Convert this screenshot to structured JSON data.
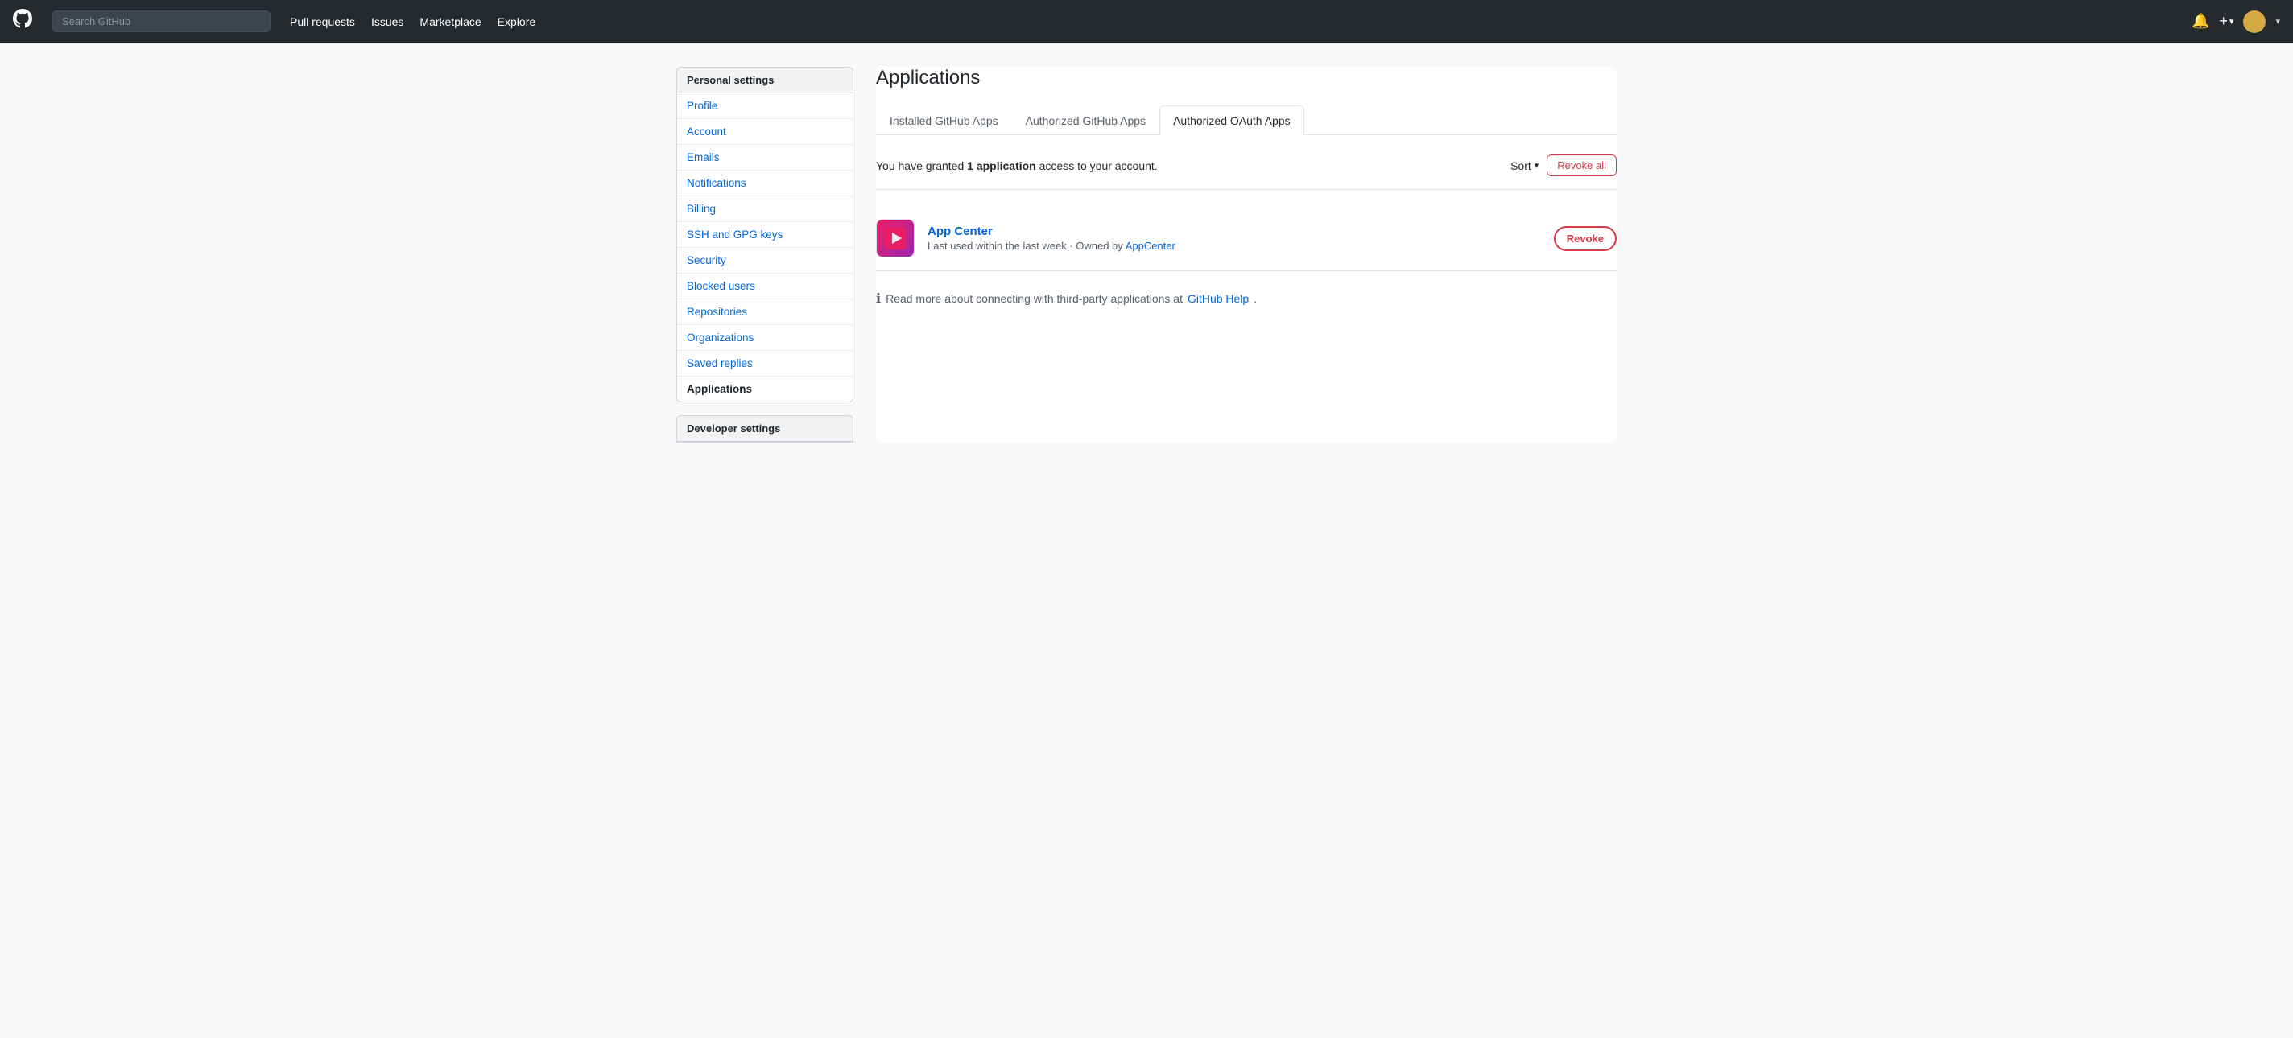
{
  "navbar": {
    "logo_label": "GitHub",
    "search_placeholder": "Search GitHub",
    "links": [
      {
        "label": "Pull requests",
        "key": "pull-requests"
      },
      {
        "label": "Issues",
        "key": "issues"
      },
      {
        "label": "Marketplace",
        "key": "marketplace"
      },
      {
        "label": "Explore",
        "key": "explore"
      }
    ]
  },
  "sidebar": {
    "personal_settings_label": "Personal settings",
    "items": [
      {
        "label": "Profile",
        "key": "profile",
        "active": false
      },
      {
        "label": "Account",
        "key": "account",
        "active": false
      },
      {
        "label": "Emails",
        "key": "emails",
        "active": false
      },
      {
        "label": "Notifications",
        "key": "notifications",
        "active": false
      },
      {
        "label": "Billing",
        "key": "billing",
        "active": false
      },
      {
        "label": "SSH and GPG keys",
        "key": "ssh-gpg",
        "active": false
      },
      {
        "label": "Security",
        "key": "security",
        "active": false
      },
      {
        "label": "Blocked users",
        "key": "blocked-users",
        "active": false
      },
      {
        "label": "Repositories",
        "key": "repositories",
        "active": false
      },
      {
        "label": "Organizations",
        "key": "organizations",
        "active": false
      },
      {
        "label": "Saved replies",
        "key": "saved-replies",
        "active": false
      },
      {
        "label": "Applications",
        "key": "applications",
        "active": true
      }
    ],
    "developer_settings_label": "Developer settings"
  },
  "main": {
    "page_title": "Applications",
    "tabs": [
      {
        "label": "Installed GitHub Apps",
        "key": "installed",
        "active": false
      },
      {
        "label": "Authorized GitHub Apps",
        "key": "authorized",
        "active": false
      },
      {
        "label": "Authorized OAuth Apps",
        "key": "oauth",
        "active": true
      }
    ],
    "access_text_prefix": "You have granted ",
    "access_count": "1",
    "access_unit": "application",
    "access_text_suffix": " access to your account.",
    "sort_label": "Sort",
    "revoke_all_label": "Revoke all",
    "app": {
      "name": "App Center",
      "meta_prefix": "Last used within the last week · Owned by ",
      "owner": "AppCenter",
      "revoke_label": "Revoke"
    },
    "footer_text_prefix": "Read more about connecting with third-party applications at ",
    "footer_link_label": "GitHub Help",
    "footer_text_suffix": "."
  }
}
